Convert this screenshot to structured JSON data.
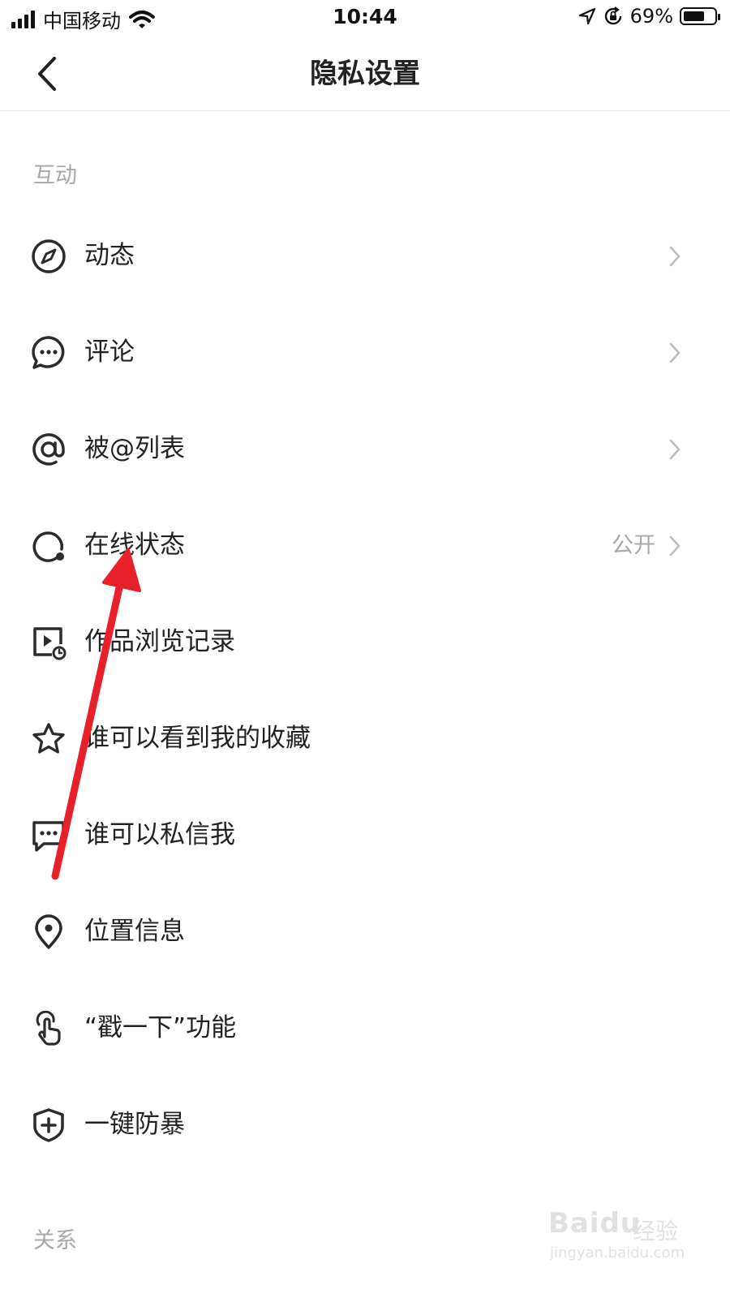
{
  "status_bar": {
    "carrier": "中国移动",
    "time": "10:44",
    "battery_percent": "69%",
    "battery_level": 0.69,
    "icons": [
      "signal-icon",
      "wifi-icon",
      "location-arrow-icon",
      "orientation-lock-icon",
      "battery-icon"
    ]
  },
  "nav": {
    "title": "隐私设置",
    "back_icon": "chevron-left-icon"
  },
  "sections": [
    {
      "header": "互动",
      "items": [
        {
          "label": "动态",
          "icon": "compass-icon",
          "value": "",
          "chevron": true
        },
        {
          "label": "评论",
          "icon": "comment-bubble-icon",
          "value": "",
          "chevron": true
        },
        {
          "label": "被@列表",
          "icon": "at-sign-icon",
          "value": "",
          "chevron": true
        },
        {
          "label": "在线状态",
          "icon": "online-status-icon",
          "value": "公开",
          "chevron": true
        },
        {
          "label": "作品浏览记录",
          "icon": "video-history-icon",
          "value": "",
          "chevron": false
        },
        {
          "label": "谁可以看到我的收藏",
          "icon": "star-icon",
          "value": "",
          "chevron": false
        },
        {
          "label": "谁可以私信我",
          "icon": "message-icon",
          "value": "",
          "chevron": false
        },
        {
          "label": "位置信息",
          "icon": "location-pin-icon",
          "value": "",
          "chevron": false
        },
        {
          "label": "“戳一下”功能",
          "icon": "tap-finger-icon",
          "value": "",
          "chevron": false
        },
        {
          "label": "一键防暴",
          "icon": "shield-plus-icon",
          "value": "",
          "chevron": false
        }
      ]
    },
    {
      "header": "关系",
      "items": []
    }
  ],
  "annotation": {
    "arrow_color": "#e8202a",
    "points_to": "在线状态"
  },
  "watermark": {
    "brand": "Baidu",
    "label": "经验",
    "url": "jingyan.baidu.com"
  },
  "colors": {
    "text_primary": "#222222",
    "text_secondary": "#a8a8a8",
    "divider": "#ebebeb",
    "icon": "#2b2b2b"
  }
}
